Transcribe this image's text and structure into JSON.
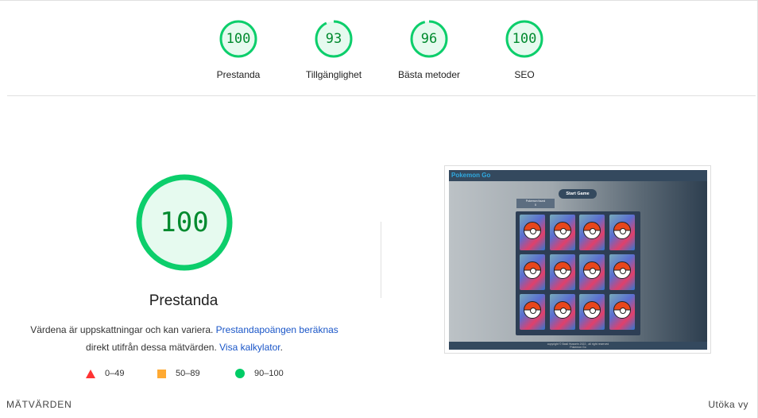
{
  "gauges": [
    {
      "score": "100",
      "label": "Prestanda",
      "fraction": 1.0
    },
    {
      "score": "93",
      "label": "Tillgänglighet",
      "fraction": 0.93
    },
    {
      "score": "96",
      "label": "Bästa metoder",
      "fraction": 0.96
    },
    {
      "score": "100",
      "label": "SEO",
      "fraction": 1.0
    }
  ],
  "main": {
    "score": "100",
    "fraction": 1.0,
    "title": "Prestanda",
    "desc_prefix": "Värdena är uppskattningar och kan variera. ",
    "desc_link1": "Prestandapoängen beräknas",
    "desc_middle": "direkt utifrån dessa mätvärden. ",
    "desc_link2": "Visa kalkylator",
    "desc_suffix": "."
  },
  "legend": [
    {
      "range": "0–49",
      "icon": "triangle-icon",
      "color": "#ff3333"
    },
    {
      "range": "50–89",
      "icon": "square-icon",
      "color": "#ffaa33"
    },
    {
      "range": "90–100",
      "icon": "circle-icon",
      "color": "#00cc66"
    }
  ],
  "screenshot": {
    "app_title": "Pokemon Go",
    "start_button": "Start Game",
    "moves_label": "Pokemon found",
    "moves_value": "0",
    "footer": "copyright © Basil Hussein 2022 , all right reserved",
    "footer2": "Pokemon Go"
  },
  "footer": {
    "metrics_label": "MÄTVÄRDEN",
    "expand_label": "Utöka vy"
  },
  "colors": {
    "pass": "#0cce6b",
    "pass_text": "#008a2e",
    "pass_bg": "#e6faef",
    "link": "#1a56c8"
  }
}
